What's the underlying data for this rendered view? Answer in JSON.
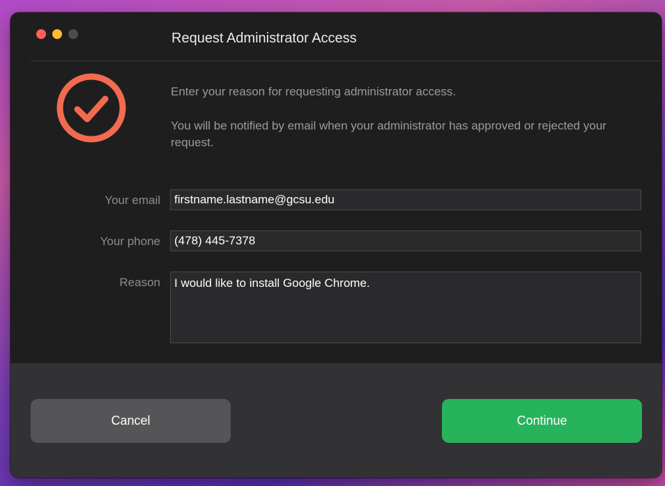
{
  "window": {
    "title": "Request Administrator Access",
    "controls": [
      "close",
      "minimize",
      "maximize"
    ]
  },
  "badge": {
    "icon": "checkmark-circle-icon",
    "color": "#f26b50"
  },
  "message": {
    "line1": "Enter your reason for requesting administrator access.",
    "line2": "You will be notified by email when your administrator has approved or rejected your request."
  },
  "form": {
    "email_label": "Your email",
    "email_value": "firstname.lastname@gcsu.edu",
    "phone_label": "Your phone",
    "phone_value": "(478) 445-7378",
    "reason_label": "Reason",
    "reason_value": "I would like to install Google Chrome."
  },
  "buttons": {
    "cancel": "Cancel",
    "continue": "Continue",
    "continue_color": "#27b35c"
  }
}
